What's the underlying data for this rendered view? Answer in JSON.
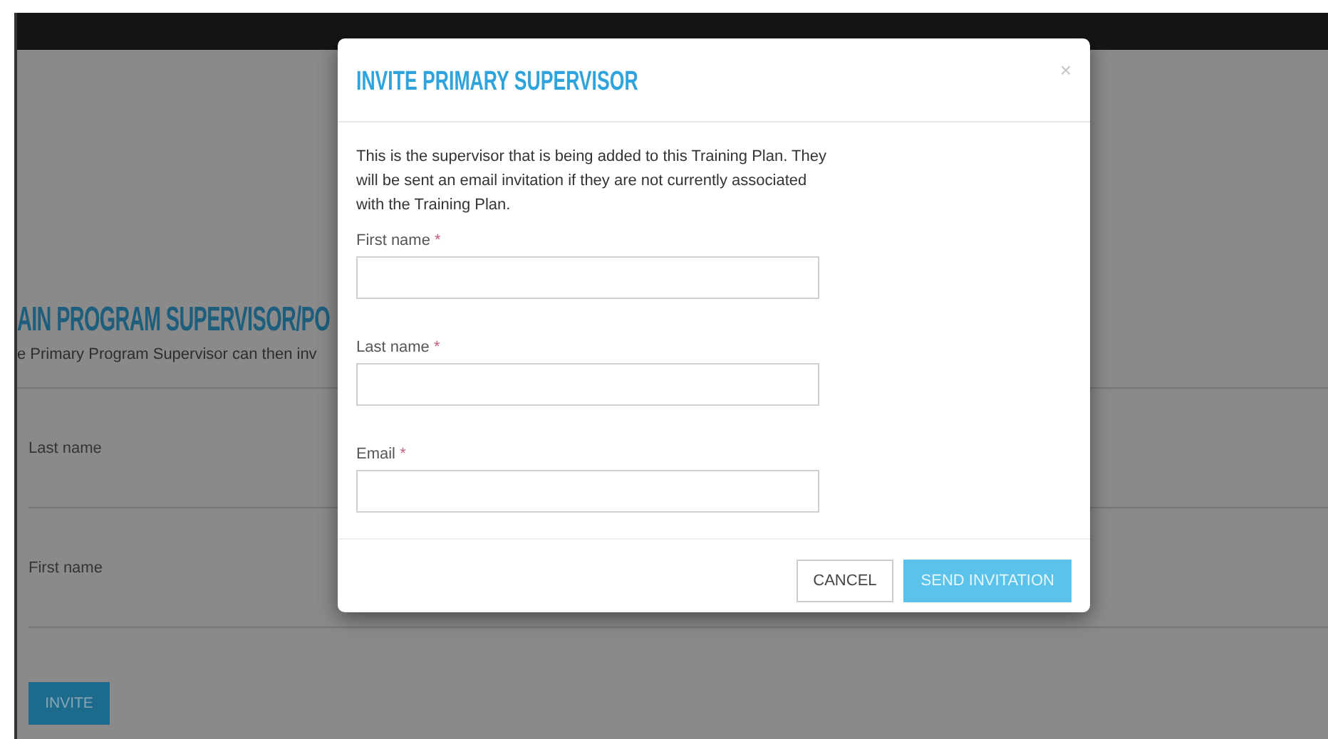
{
  "page": {
    "heading": "AIN PROGRAM SUPERVISOR/PO",
    "subtext": "e Primary Program Supervisor can then inv",
    "fields": [
      {
        "label": "Last name"
      },
      {
        "label": "First name"
      }
    ],
    "invite_button": "INVITE"
  },
  "dialog": {
    "title": "INVITE PRIMARY SUPERVISOR",
    "close": "×",
    "description": "This is the supervisor that is being added to this Training Plan. They will be sent an email invitation if they are not currently associated with the Training Plan.",
    "fields": [
      {
        "label": "First name",
        "required_mark": "*"
      },
      {
        "label": "Last name",
        "required_mark": "*"
      },
      {
        "label": "Email",
        "required_mark": "*"
      }
    ],
    "buttons": [
      {
        "label": "CANCEL",
        "kind": "secondary"
      },
      {
        "label": "SEND INVITATION",
        "kind": "primary"
      }
    ]
  }
}
